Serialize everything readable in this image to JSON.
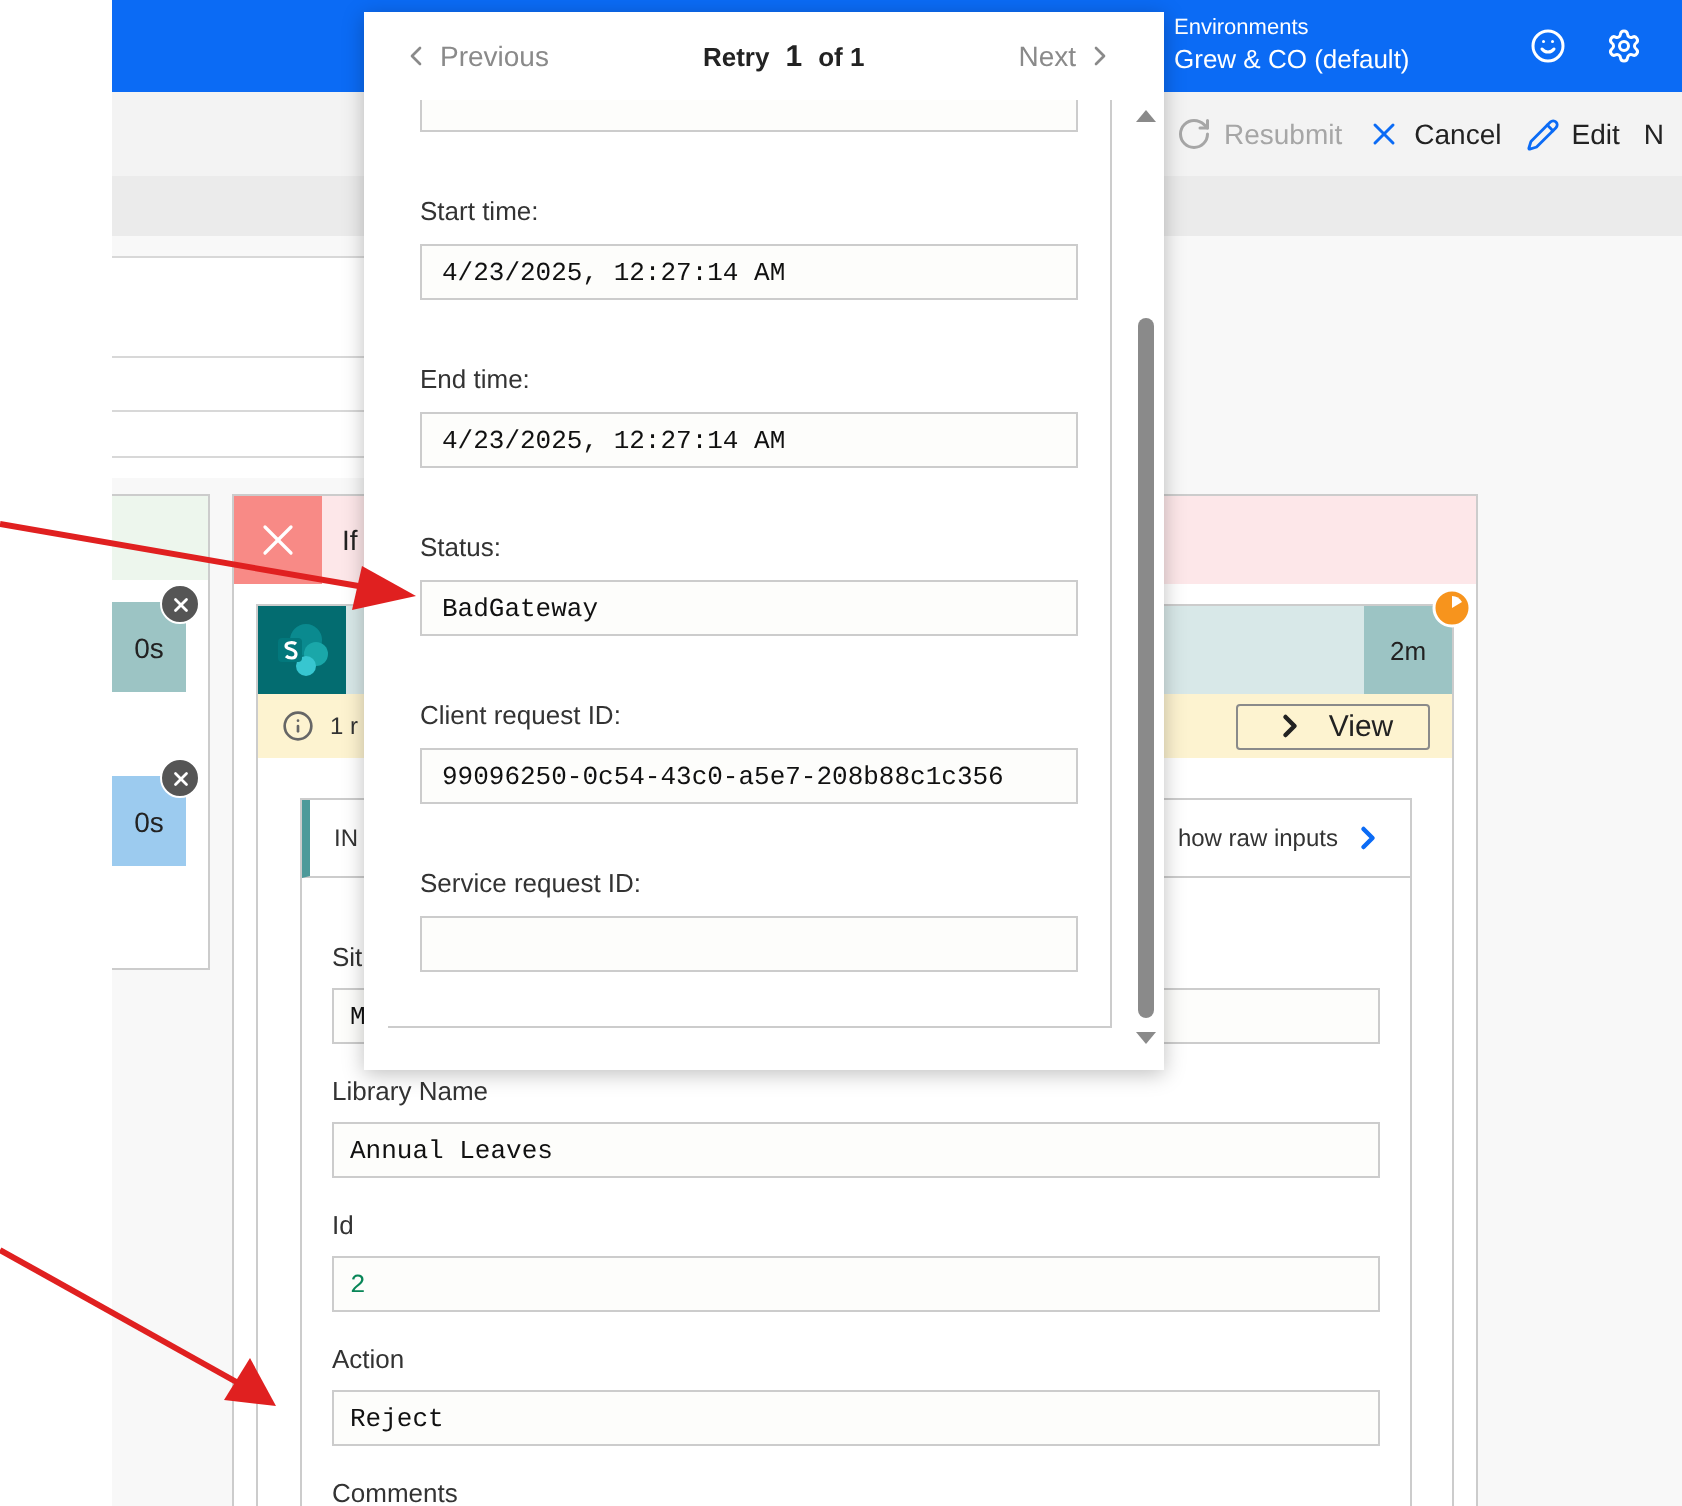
{
  "header": {
    "environment_label": "Environments",
    "environment_name": "Grew & CO (default)"
  },
  "toolbar": {
    "buttons": [
      {
        "kind": "resubmit",
        "label": "Resubmit",
        "disabled": true
      },
      {
        "kind": "cancel",
        "label": "Cancel",
        "disabled": false
      },
      {
        "kind": "edit",
        "label": "Edit",
        "disabled": false
      },
      {
        "kind": "more",
        "label": "N",
        "disabled": false
      }
    ]
  },
  "left_card": {
    "tiles": [
      {
        "duration": "0s",
        "color": "#9cc4c4"
      },
      {
        "duration": "0s",
        "color": "#9ccbef"
      }
    ]
  },
  "condition_card": {
    "title": "If",
    "failed": true
  },
  "action_card": {
    "duration": "2m",
    "banner_text": "1 r",
    "view_button": "View",
    "inputs_tab": "IN",
    "show_raw_inputs": "how raw inputs",
    "fields": [
      {
        "label": "Sit",
        "value": "M",
        "kind": "text"
      },
      {
        "label": "Library Name",
        "value": "Annual Leaves",
        "kind": "text"
      },
      {
        "label": "Id",
        "value": "2",
        "kind": "number"
      },
      {
        "label": "Action",
        "value": "Reject",
        "kind": "text"
      },
      {
        "label": "Comments"
      }
    ]
  },
  "retry_popup": {
    "previous": {
      "label": "Previous",
      "disabled": true
    },
    "retry_label": "Retry",
    "attempt": "1",
    "total": "of 1",
    "next": {
      "label": "Next",
      "disabled": true
    },
    "fields": [
      {
        "kind": "field"
      },
      {
        "label": "Start time:",
        "value": "4/23/2025, 12:27:14 AM"
      },
      {
        "label": "End time:",
        "value": "4/23/2025, 12:27:14 AM"
      },
      {
        "label": "Status:",
        "value": "BadGateway"
      },
      {
        "label": "Client request ID:",
        "value": "99096250-0c54-43c0-a5e7-208b88c1c356"
      },
      {
        "label": "Service request ID:"
      }
    ]
  }
}
